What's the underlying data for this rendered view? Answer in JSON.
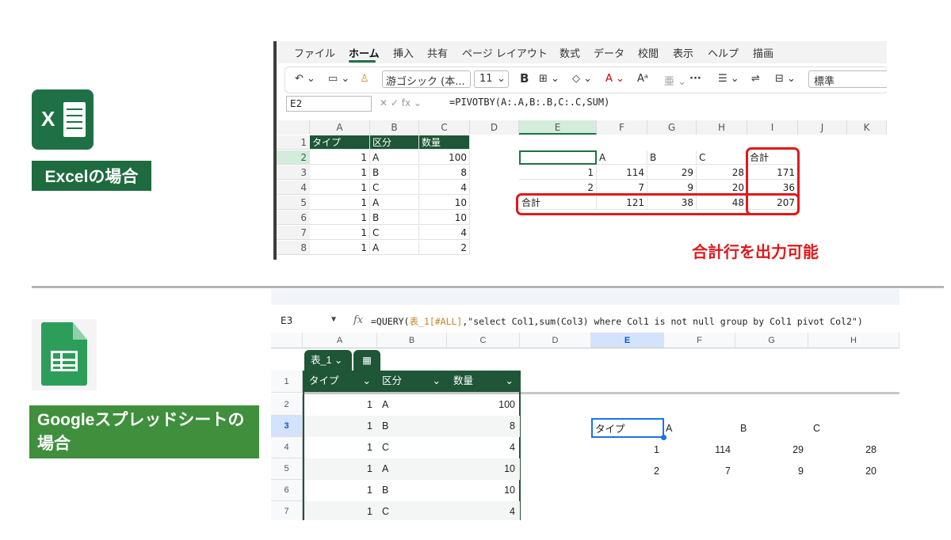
{
  "excel": {
    "label": "Excelの場合",
    "menu": [
      "ファイル",
      "ホーム",
      "挿入",
      "共有",
      "ページ レイアウト",
      "数式",
      "データ",
      "校閲",
      "表示",
      "ヘルプ",
      "描画"
    ],
    "ribbon": {
      "font": "游ゴシック (本...",
      "size": "11",
      "style": "標準"
    },
    "name_box": "E2",
    "formula": "=PIVOTBY(A:.A,B:.B,C:.C,SUM)",
    "columns": [
      "A",
      "B",
      "C",
      "D",
      "E",
      "F",
      "G",
      "H",
      "I",
      "J",
      "K"
    ],
    "rows": [
      "1",
      "2",
      "3",
      "4",
      "5",
      "6",
      "7",
      "8"
    ],
    "table_headers": [
      "タイプ",
      "区分",
      "数量"
    ],
    "table_rows": [
      [
        "1",
        "A",
        "100"
      ],
      [
        "1",
        "B",
        "8"
      ],
      [
        "1",
        "C",
        "4"
      ],
      [
        "1",
        "A",
        "10"
      ],
      [
        "1",
        "B",
        "10"
      ],
      [
        "1",
        "C",
        "4"
      ],
      [
        "1",
        "A",
        "2"
      ]
    ],
    "pivot": {
      "headers": [
        "A",
        "B",
        "C",
        "合計"
      ],
      "rows": [
        [
          "1",
          "114",
          "29",
          "28",
          "171"
        ],
        [
          "2",
          "7",
          "9",
          "20",
          "36"
        ],
        [
          "合計",
          "121",
          "38",
          "48",
          "207"
        ]
      ]
    },
    "annotation": "合計行を出力可能"
  },
  "sheets": {
    "label": "Googleスプレッドシートの場合",
    "name_box": "E3",
    "formula_prefix": "=QUERY(",
    "formula_ref": "表_1[#ALL]",
    "formula_suffix": ",\"select Col1,sum(Col3) where Col1 is not null group by Col1 pivot Col2\")",
    "columns": [
      "A",
      "B",
      "C",
      "D",
      "E",
      "F",
      "G",
      "H"
    ],
    "rows": [
      "1",
      "2",
      "3",
      "4",
      "5",
      "6",
      "7"
    ],
    "table_name": "表_1",
    "table_headers": [
      "タイプ",
      "区分",
      "数量"
    ],
    "table_rows": [
      [
        "1",
        "A",
        "100"
      ],
      [
        "1",
        "B",
        "8"
      ],
      [
        "1",
        "C",
        "4"
      ],
      [
        "1",
        "A",
        "10"
      ],
      [
        "1",
        "B",
        "10"
      ],
      [
        "1",
        "C",
        "4"
      ]
    ],
    "pivot": {
      "headers": [
        "タイプ",
        "A",
        "B",
        "C"
      ],
      "rows": [
        [
          "1",
          "114",
          "29",
          "28"
        ],
        [
          "2",
          "7",
          "9",
          "20"
        ]
      ]
    }
  },
  "colors": {
    "excel_green": "#1d6b3e",
    "sheets_green": "#3f8f3d",
    "highlight_red": "#e0191c",
    "table_header": "#1e5637"
  }
}
